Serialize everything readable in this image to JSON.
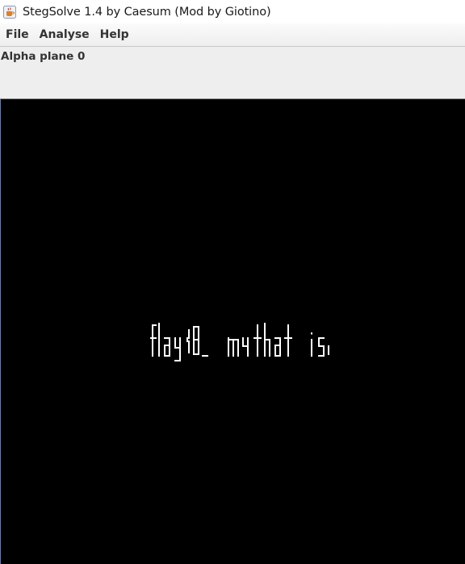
{
  "window": {
    "title": "StegSolve 1.4 by Caesum (Mod by Giotino)",
    "icon": "java-cup-icon"
  },
  "menubar": {
    "items": [
      {
        "label": "File"
      },
      {
        "label": "Analyse"
      },
      {
        "label": "Help"
      }
    ]
  },
  "panel": {
    "plane_label": "Alpha plane 0"
  },
  "image": {
    "background": "#000000",
    "hidden_text": "flag{8_my_that_is}",
    "text_color": "#ffffff"
  }
}
